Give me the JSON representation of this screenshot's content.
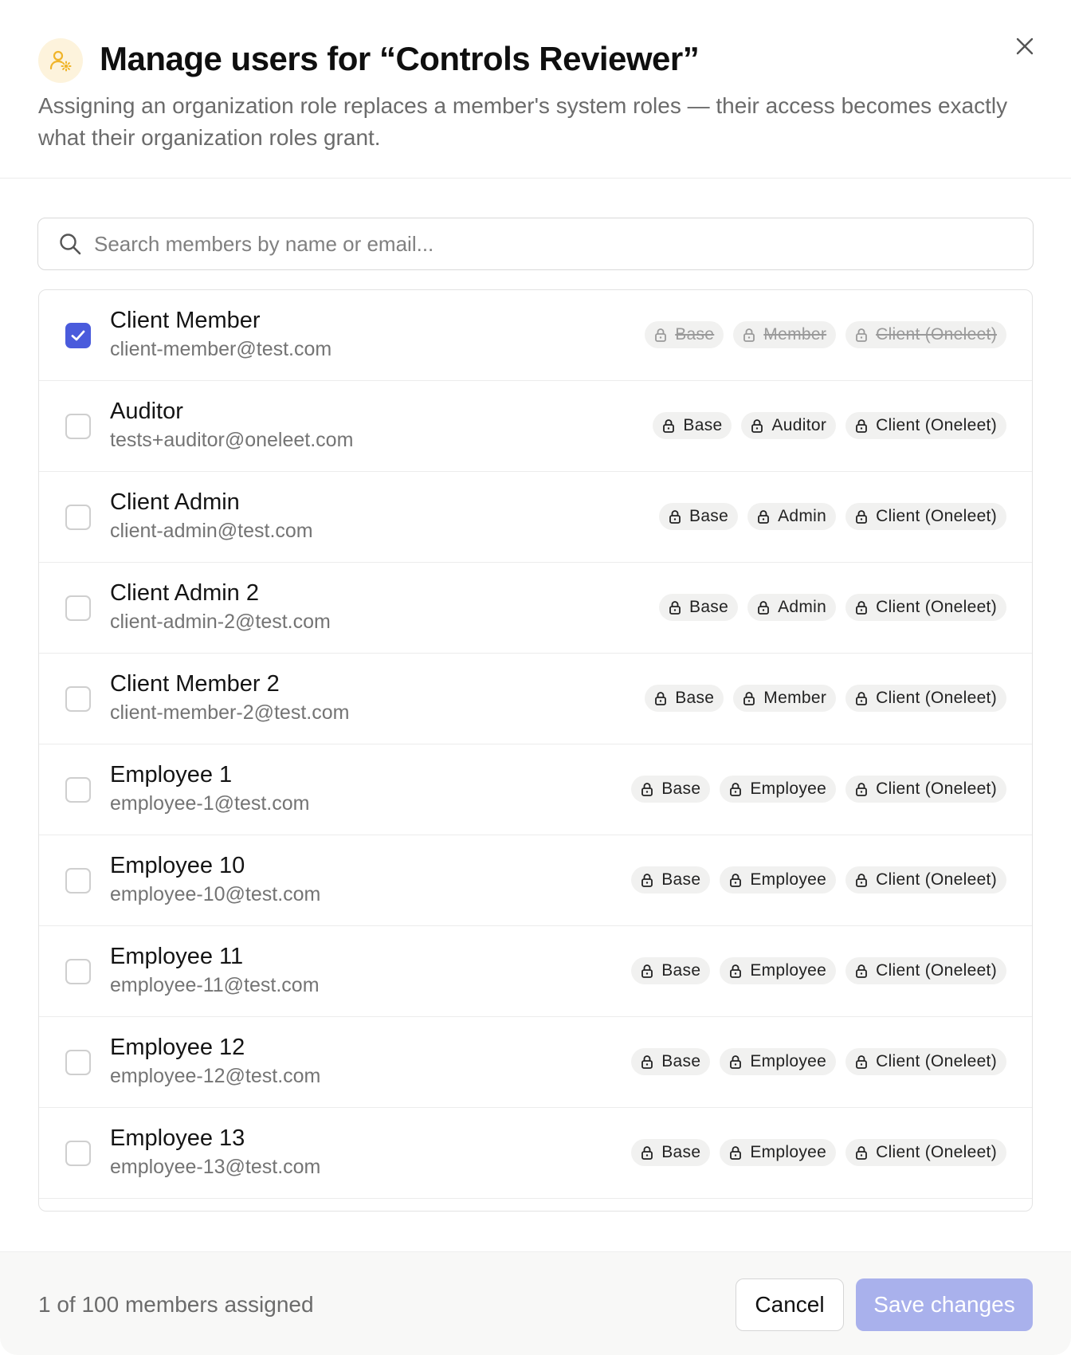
{
  "dialog": {
    "title": "Manage users for “Controls Reviewer”",
    "subtitle": "Assigning an organization role replaces a member's system roles — their access becomes exactly what their organization roles grant.",
    "icon": "user-gear-icon",
    "close_icon": "close-icon"
  },
  "search": {
    "placeholder": "Search members by name or email...",
    "value": "",
    "icon": "search-icon"
  },
  "members": [
    {
      "name": "Client Member",
      "email": "client-member@test.com",
      "checked": true,
      "roles": [
        "Base",
        "Member",
        "Client (Oneleet)"
      ]
    },
    {
      "name": "Auditor",
      "email": "tests+auditor@oneleet.com",
      "checked": false,
      "roles": [
        "Base",
        "Auditor",
        "Client (Oneleet)"
      ]
    },
    {
      "name": "Client Admin",
      "email": "client-admin@test.com",
      "checked": false,
      "roles": [
        "Base",
        "Admin",
        "Client (Oneleet)"
      ]
    },
    {
      "name": "Client Admin 2",
      "email": "client-admin-2@test.com",
      "checked": false,
      "roles": [
        "Base",
        "Admin",
        "Client (Oneleet)"
      ]
    },
    {
      "name": "Client Member 2",
      "email": "client-member-2@test.com",
      "checked": false,
      "roles": [
        "Base",
        "Member",
        "Client (Oneleet)"
      ]
    },
    {
      "name": "Employee 1",
      "email": "employee-1@test.com",
      "checked": false,
      "roles": [
        "Base",
        "Employee",
        "Client (Oneleet)"
      ]
    },
    {
      "name": "Employee 10",
      "email": "employee-10@test.com",
      "checked": false,
      "roles": [
        "Base",
        "Employee",
        "Client (Oneleet)"
      ]
    },
    {
      "name": "Employee 11",
      "email": "employee-11@test.com",
      "checked": false,
      "roles": [
        "Base",
        "Employee",
        "Client (Oneleet)"
      ]
    },
    {
      "name": "Employee 12",
      "email": "employee-12@test.com",
      "checked": false,
      "roles": [
        "Base",
        "Employee",
        "Client (Oneleet)"
      ]
    },
    {
      "name": "Employee 13",
      "email": "employee-13@test.com",
      "checked": false,
      "roles": [
        "Base",
        "Employee",
        "Client (Oneleet)"
      ]
    }
  ],
  "role_icon": "lock-icon",
  "footer": {
    "assigned_text": "1 of 100 members assigned",
    "cancel_label": "Cancel",
    "save_label": "Save changes"
  },
  "colors": {
    "accent": "#4a5bdc",
    "save_disabled": "#a9b1ec",
    "header_icon_bg": "#fdf3dc",
    "header_icon_fg": "#f0b429",
    "role_bg": "#f1f1f0"
  }
}
